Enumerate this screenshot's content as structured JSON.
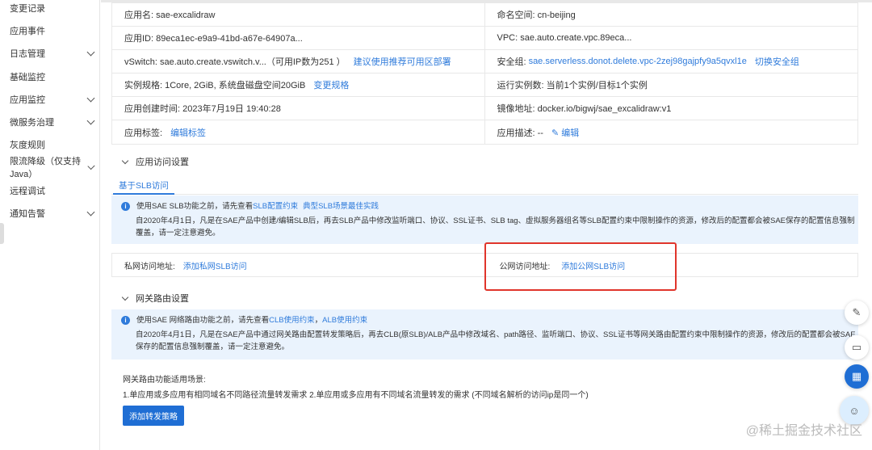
{
  "sidebar": {
    "items": [
      {
        "label": "变更记录",
        "expandable": false
      },
      {
        "label": "应用事件",
        "expandable": false
      },
      {
        "label": "日志管理",
        "expandable": true
      },
      {
        "label": "基础监控",
        "expandable": false
      },
      {
        "label": "应用监控",
        "expandable": true
      },
      {
        "label": "微服务治理",
        "expandable": true
      },
      {
        "label": "灰度规则",
        "expandable": false
      },
      {
        "label": "限流降级（仅支持Java）",
        "expandable": true
      },
      {
        "label": "远程调试",
        "expandable": false
      },
      {
        "label": "通知告警",
        "expandable": true
      }
    ]
  },
  "info_table": {
    "left": [
      {
        "text": "应用名: sae-excalidraw",
        "link": ""
      },
      {
        "text": "应用ID: 89eca1ec-e9a9-41bd-a67e-64907a...",
        "link": ""
      },
      {
        "text": "vSwitch: sae.auto.create.vswitch.v...（可用IP数为251 ）",
        "link": "建议使用推荐可用区部署"
      },
      {
        "text": "实例规格: 1Core, 2GiB, 系统盘磁盘空间20GiB",
        "link": "变更规格"
      },
      {
        "text": "应用创建时间: 2023年7月19日 19:40:28",
        "link": ""
      },
      {
        "text": "应用标签:",
        "link": "编辑标签"
      }
    ],
    "right": [
      {
        "text": "命名空间: cn-beijing",
        "value_link": "",
        "link": ""
      },
      {
        "text": "VPC: sae.auto.create.vpc.89eca...",
        "value_link": "",
        "link": ""
      },
      {
        "text": "安全组:",
        "value_link": "sae.serverless.donot.delete.vpc-2zej98gajpfy9a5qvxl1e",
        "link": "切换安全组"
      },
      {
        "text": "运行实例数: 当前1个实例/目标1个实例",
        "value_link": "",
        "link": ""
      },
      {
        "text": "镜像地址: docker.io/bigwj/sae_excalidraw:v1",
        "value_link": "",
        "link": ""
      },
      {
        "text": "应用描述: --",
        "value_link": "",
        "link": "✎ 编辑"
      }
    ]
  },
  "access": {
    "section_title": "应用访问设置",
    "tab": "基于SLB访问",
    "notice_prefix": "使用SAE SLB功能之前，请先查看",
    "notice_link1": "SLB配置约束",
    "notice_link2": "典型SLB场景最佳实践",
    "notice_body": "自2020年4月1日，凡是在SAE产品中创建/编辑SLB后，再去SLB产品中修改监听端口、协议、SSL证书、SLB tag、虚拟服务器组名等SLB配置约束中限制操作的资源，修改后的配置都会被SAE保存的配置信息强制覆盖，请一定注意避免。",
    "private_label": "私网访问地址:",
    "private_link": "添加私网SLB访问",
    "public_label": "公网访问地址:",
    "public_link": "添加公网SLB访问"
  },
  "gateway": {
    "section_title": "网关路由设置",
    "notice_prefix": "使用SAE 网络路由功能之前，请先查看",
    "notice_link1": "CLB使用约束",
    "notice_sep": "，",
    "notice_link2": "ALB使用约束",
    "notice_body": "自2020年4月1日，凡是在SAE产品中通过网关路由配置转发策略后，再去CLB(原SLB)/ALB产品中修改域名、path路径、监听端口、协议、SSL证书等网关路由配置约束中限制操作的资源，修改后的配置都会被SAE保存的配置信息强制覆盖，请一定注意避免。",
    "scenario_title": "网关路由功能适用场景:",
    "scenario_text": "1.单应用或多应用有相同域名不同路径流量转发需求 2.单应用或多应用有不同域名流量转发的需求 (不同域名解析的访问ip是同一个)",
    "button": "添加转发策略"
  },
  "watermark": "@稀土掘金技术社区"
}
